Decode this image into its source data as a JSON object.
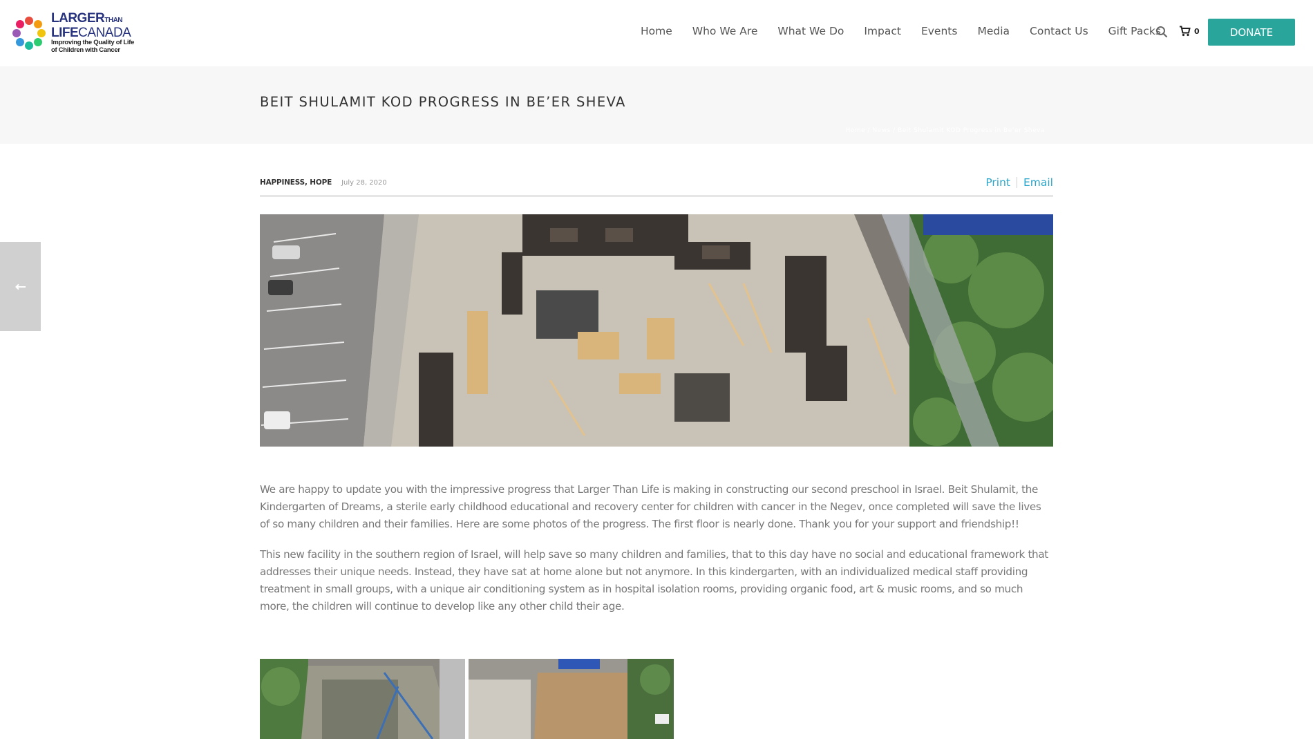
{
  "logo": {
    "line1": "LARGER",
    "line1_small": "THAN",
    "line2_bold": "LIFE",
    "line2_light": "CANADA",
    "line3": "Improving the Quality of Life",
    "line4": "of Children with Cancer",
    "colors": [
      "#e84c3d",
      "#f39c12",
      "#f1c40f",
      "#2ecc71",
      "#1abc9c",
      "#3498db",
      "#9b59b6",
      "#e91e63"
    ]
  },
  "nav": {
    "items": [
      "Home",
      "Who We Are",
      "What We Do",
      "Impact",
      "Events",
      "Media",
      "Contact Us",
      "Gift Packs"
    ],
    "cart_count": "0",
    "donate_label": "DONATE"
  },
  "page": {
    "title": "BEIT SHULAMIT KOD PROGRESS IN BE’ER SHEVA",
    "breadcrumb": "Home / News / Beit Shulamit KOD Progress in Be’er Sheva"
  },
  "post": {
    "categories": "HAPPINESS, HOPE",
    "date": "July 28, 2020",
    "print_label": "Print",
    "email_label": "Email",
    "paragraph1": "We are happy to update you with the impressive progress that Larger Than Life is making in constructing our second preschool in Israel. Beit Shulamit, the Kindergarten of Dreams, a sterile early childhood educational and recovery center for children with cancer in the Negev, once completed will save the lives of so many children and their families. Here are some photos of the progress. The first floor is nearly done. Thank you for your support and friendship!!",
    "paragraph2": "This new facility in the southern region of Israel, will help save so many children and families, that to this day have no social and educational framework that addresses their unique needs. Instead, they have sat at home alone but not anymore. In this kindergarten, with an individualized medical staff providing treatment in small groups, with a unique air conditioning system as in hospital isolation rooms, providing organic food, art & music rooms, and so much more, the children will continue to develop like any other child their age."
  },
  "icons": {
    "search": "search-icon",
    "cart": "cart-icon",
    "prev": "arrow-left-icon"
  },
  "colors": {
    "accent": "#2aa59c",
    "link": "#2aa5c9",
    "brand": "#27337f"
  }
}
